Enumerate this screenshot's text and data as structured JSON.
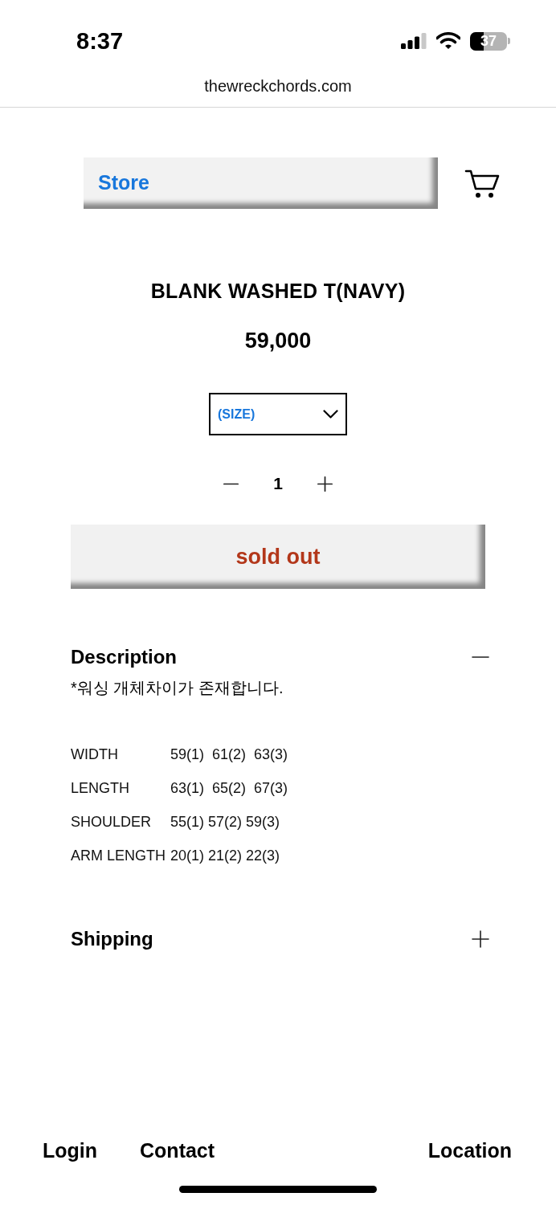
{
  "status_bar": {
    "time": "8:37",
    "battery": "37"
  },
  "address_bar": {
    "url": "thewreckchords.com"
  },
  "header": {
    "store_label": "Store"
  },
  "product": {
    "title": "BLANK WASHED T(NAVY)",
    "price": "59,000",
    "size_select": {
      "placeholder": "(SIZE)"
    },
    "quantity": "1",
    "button_label": "sold out"
  },
  "sections": [
    {
      "title": "Description",
      "expanded": true,
      "note": "*워싱 개체차이가 존재합니다.",
      "size_rows": [
        {
          "label": "WIDTH",
          "values": "59(1)  61(2)  63(3)"
        },
        {
          "label": "LENGTH",
          "values": "63(1)  65(2)  67(3)"
        },
        {
          "label": "SHOULDER",
          "values": "55(1) 57(2) 59(3)"
        },
        {
          "label": "ARM LENGTH",
          "values": "20(1) 21(2) 22(3)"
        }
      ]
    },
    {
      "title": "Shipping",
      "expanded": false
    }
  ],
  "footer_links": [
    "Login",
    "Contact",
    "Location"
  ]
}
